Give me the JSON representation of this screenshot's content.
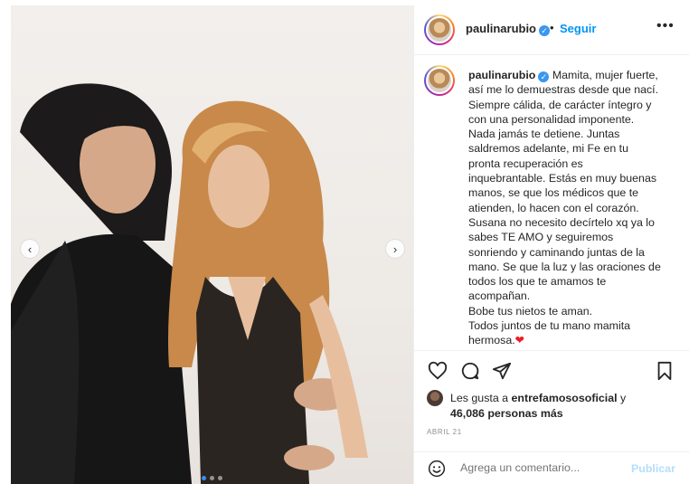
{
  "post": {
    "username": "paulinarubio",
    "verified_mark": "✓",
    "separator": "•",
    "follow_label": "Seguir",
    "more_label": "•••"
  },
  "caption": {
    "username": "paulinarubio",
    "lines": [
      "Mamita, mujer fuerte,",
      "así me lo demuestras desde que nací.",
      "Siempre cálida, de carácter íntegro y",
      "con una personalidad imponente.",
      "Nada jamás te detiene. Juntas",
      "saldremos adelante, mi Fe en tu",
      "pronta recuperación es",
      "inquebrantable. Estás en muy buenas",
      "manos, se que los médicos que te",
      "atienden, lo hacen con el corazón.",
      "Susana no necesito decírtelo xq ya lo",
      "sabes TE AMO y seguiremos",
      "sonriendo y caminando juntas de la",
      "mano. Se que la luz y las oraciones de",
      "todos los que te amamos te",
      "acompañan.",
      "Bobe tus nietos te aman.",
      "Todos juntos de tu mano mamita",
      "hermosa."
    ],
    "heart_emoji": "❤"
  },
  "likes": {
    "prefix": "Les gusta a ",
    "liker": "entrefamososoficial",
    "connector": " y",
    "count": "46,086 personas más"
  },
  "date": "ABRIL 21",
  "comment": {
    "placeholder": "Agrega un comentario...",
    "post_label": "Publicar"
  },
  "carousel": {
    "prev_label": "‹",
    "next_label": "›",
    "total_slides": 3,
    "active_slide": 1
  },
  "icons": [
    "like-icon",
    "comment-icon",
    "share-icon",
    "save-icon",
    "emoji-icon",
    "verified-icon"
  ],
  "colors": {
    "link_blue": "#0095f6",
    "verified_blue": "#3897f0",
    "muted_gray": "#8e8e8e",
    "publish_disabled": "#b2dffc",
    "heart_red": "#ed1c24"
  }
}
